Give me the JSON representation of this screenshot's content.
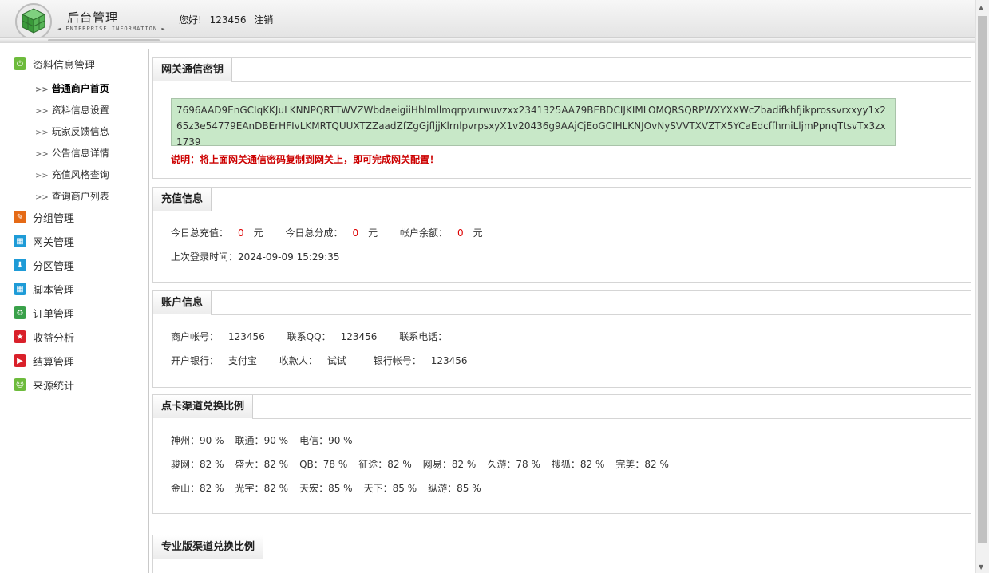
{
  "header": {
    "title": "后台管理",
    "subtitle": "◄ ENTERPRISE INFORMATION ►",
    "greeting": "您好!",
    "username": "123456",
    "logout": "注销"
  },
  "sidebar": {
    "groups": [
      {
        "label": "资料信息管理",
        "icon": "power-icon",
        "color": "#6dbb3c"
      },
      {
        "label": "分组管理",
        "icon": "pencil-icon",
        "color": "#e56a16"
      },
      {
        "label": "网关管理",
        "icon": "grid-icon",
        "color": "#1e9bd7"
      },
      {
        "label": "分区管理",
        "icon": "download-icon",
        "color": "#1e9bd7"
      },
      {
        "label": "脚本管理",
        "icon": "grid-icon",
        "color": "#1e9bd7"
      },
      {
        "label": "订单管理",
        "icon": "recycle-icon",
        "color": "#3aa14a"
      },
      {
        "label": "收益分析",
        "icon": "star-icon",
        "color": "#d9202a"
      },
      {
        "label": "结算管理",
        "icon": "play-icon",
        "color": "#d9202a"
      },
      {
        "label": "来源统计",
        "icon": "smile-icon",
        "color": "#6dbb3c"
      }
    ],
    "subitems": [
      {
        "label": "普通商户首页"
      },
      {
        "label": "资料信息设置"
      },
      {
        "label": "玩家反馈信息"
      },
      {
        "label": "公告信息详情"
      },
      {
        "label": "充值风格查询"
      },
      {
        "label": "查询商户列表"
      }
    ],
    "arrow": ">>"
  },
  "gateway": {
    "tab": "网关通信密钥",
    "secret": "7696AAD9EnGCIqKKJuLKNNPQRTTWVZWbdaeigiiHhlmllmqrpvurwuvzxx2341325AA79BEBDCIJKIMLOMQRSQRPWXYXXWcZbadifkhfjikprossvrxxyy1x265z3e54779EAnDBErHFIvLKMRTQUUXTZZaadZfZgGjfljjKlrnlpvrpsxyX1v20436g9AAjCjEoGCIHLKNJOvNySVVTXVZTX5YCaEdcffhmiLljmPpnqTtsvTx3zx1739",
    "note": "说明：将上面网关通信密码复制到网关上，即可完成网关配置！"
  },
  "recharge": {
    "tab": "充值信息",
    "today_total_label": "今日总充值：",
    "today_total": "0",
    "today_share_label": "今日总分成：",
    "today_share": "0",
    "balance_label": "帐户余额：",
    "balance": "0",
    "unit": "元",
    "last_login_label": "上次登录时间：",
    "last_login": "2024-09-09 15:29:35"
  },
  "account": {
    "tab": "账户信息",
    "merchant_label": "商户帐号：",
    "merchant": "123456",
    "qq_label": "联系QQ：",
    "qq": "123456",
    "phone_label": "联系电话：",
    "phone": "",
    "bank_label": "开户银行：",
    "bank": "支付宝",
    "payee_label": "收款人：",
    "payee": "试试",
    "bank_no_label": "银行帐号：",
    "bank_no": "123456"
  },
  "card_rates": {
    "tab": "点卡渠道兑换比例",
    "rows": [
      [
        {
          "name": "神州",
          "rate": "90 %"
        },
        {
          "name": "联通",
          "rate": "90 %"
        },
        {
          "name": "电信",
          "rate": "90 %"
        }
      ],
      [
        {
          "name": "骏网",
          "rate": "82 %"
        },
        {
          "name": "盛大",
          "rate": "82 %"
        },
        {
          "name": "QB",
          "rate": "78 %"
        },
        {
          "name": "征途",
          "rate": "82 %"
        },
        {
          "name": "网易",
          "rate": "82 %"
        },
        {
          "name": "久游",
          "rate": "78 %"
        },
        {
          "name": "搜狐",
          "rate": "82 %"
        },
        {
          "name": "完美",
          "rate": "82 %"
        }
      ],
      [
        {
          "name": "金山",
          "rate": "82 %"
        },
        {
          "name": "光宇",
          "rate": "82 %"
        },
        {
          "name": "天宏",
          "rate": "85 %"
        },
        {
          "name": "天下",
          "rate": "85 %"
        },
        {
          "name": "纵游",
          "rate": "85 %"
        }
      ]
    ]
  },
  "pro_rates": {
    "tab": "专业版渠道兑换比例"
  },
  "colors": {
    "secret_bg": "#c8e8c8",
    "zero_value": "#dd0000",
    "note": "#cc0000"
  }
}
